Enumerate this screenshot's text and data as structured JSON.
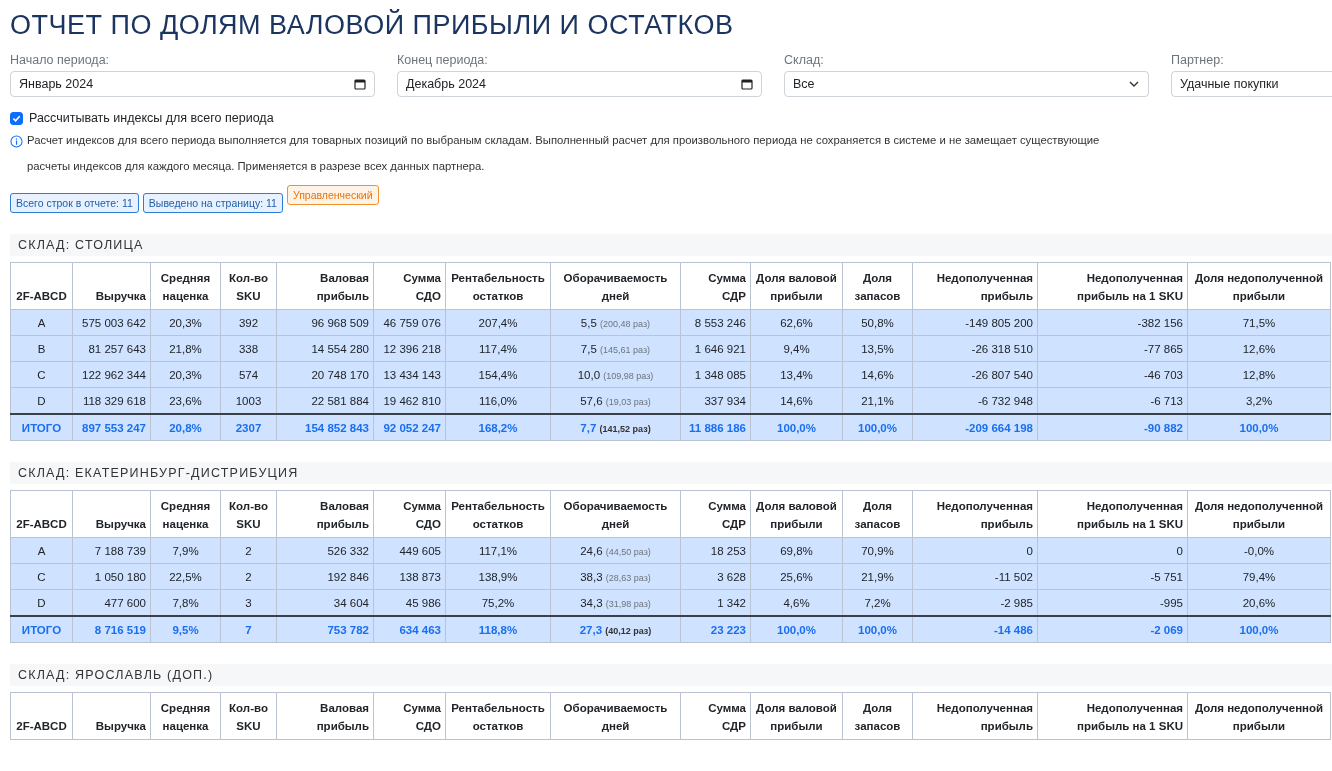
{
  "title": "ОТЧЕТ ПО ДОЛЯМ ВАЛОВОЙ ПРИБЫЛИ И ОСТАТКОВ",
  "filters": [
    {
      "label": "Начало периода:",
      "value": "Январь 2024",
      "kind": "date"
    },
    {
      "label": "Конец периода:",
      "value": "Декабрь 2024",
      "kind": "date"
    },
    {
      "label": "Склад:",
      "value": "Все",
      "kind": "select"
    },
    {
      "label": "Партнер:",
      "value": "Удачные покупки",
      "kind": "text"
    }
  ],
  "checkbox": {
    "label": "Рассчитывать индексы для всего периода",
    "checked": true
  },
  "info": "Расчет индексов для всего периода выполняется для товарных позиций по выбраным складам. Выполненный расчет для произвольного периода не сохраняется в системе и не замещает существующие расчеты индексов для каждого месяца. Применяется в разрезе всех данных партнера.",
  "badges": [
    {
      "text": "Всего строк в отчете: 11",
      "kind": "info"
    },
    {
      "text": "Выведено на страницу: 11",
      "kind": "info"
    },
    {
      "text": "Управленческий",
      "kind": "warning"
    }
  ],
  "sections": [
    {
      "title": "СКЛАД: СТОЛИЦА",
      "columns": [
        "2F-ABCD",
        "Выручка",
        "Средняя наценка",
        "Кол-во SKU",
        "Валовая прибыль",
        "Сумма СДО",
        "Рентабельность остатков",
        "Оборачиваемость дней",
        "Сумма СДР",
        "Доля валовой прибыли",
        "Доля запасов",
        "Недополученная прибыль",
        "Недополученная прибыль на 1 SKU",
        "Доля недополученной прибыли"
      ],
      "rows": [
        {
          "cells": [
            "A",
            "575 003 642",
            "20,3%",
            "392",
            "96 968 509",
            "46 759 076",
            "207,4%",
            {
              "value": "5,5",
              "note": "(200,48 раз)"
            },
            "8 553 246",
            "62,6%",
            "50,8%",
            "-149 805 200",
            "-382 156",
            "71,5%"
          ]
        },
        {
          "cells": [
            "B",
            "81 257 643",
            "21,8%",
            "338",
            "14 554 280",
            "12 396 218",
            "117,4%",
            {
              "value": "7,5",
              "note": "(145,61 раз)"
            },
            "1 646 921",
            "9,4%",
            "13,5%",
            "-26 318 510",
            "-77 865",
            "12,6%"
          ]
        },
        {
          "cells": [
            "C",
            "122 962 344",
            "20,3%",
            "574",
            "20 748 170",
            "13 434 143",
            "154,4%",
            {
              "value": "10,0",
              "note": "(109,98 раз)"
            },
            "1 348 085",
            "13,4%",
            "14,6%",
            "-26 807 540",
            "-46 703",
            "12,8%"
          ]
        },
        {
          "cells": [
            "D",
            "118 329 618",
            "23,6%",
            "1003",
            "22 581 884",
            "19 462 810",
            "116,0%",
            {
              "value": "57,6",
              "note": "(19,03 раз)"
            },
            "337 934",
            "14,6%",
            "21,1%",
            "-6 732 948",
            "-6 713",
            "3,2%"
          ]
        }
      ],
      "total": [
        "ИТОГО",
        "897 553 247",
        "20,8%",
        "2307",
        "154 852 843",
        "92 052 247",
        "168,2%",
        {
          "value": "7,7",
          "note": "(141,52 раз)"
        },
        "11 886 186",
        "100,0%",
        "100,0%",
        "-209 664 198",
        "-90 882",
        "100,0%"
      ]
    },
    {
      "title": "СКЛАД: ЕКАТЕРИНБУРГ-ДИСТРИБУЦИЯ",
      "columns": [
        "2F-ABCD",
        "Выручка",
        "Средняя наценка",
        "Кол-во SKU",
        "Валовая прибыль",
        "Сумма СДО",
        "Рентабельность остатков",
        "Оборачиваемость дней",
        "Сумма СДР",
        "Доля валовой прибыли",
        "Доля запасов",
        "Недополученная прибыль",
        "Недополученная прибыль на 1 SKU",
        "Доля недополученной прибыли"
      ],
      "rows": [
        {
          "cells": [
            "A",
            "7 188 739",
            "7,9%",
            "2",
            "526 332",
            "449 605",
            "117,1%",
            {
              "value": "24,6",
              "note": "(44,50 раз)"
            },
            "18 253",
            "69,8%",
            "70,9%",
            "0",
            "0",
            "-0,0%"
          ]
        },
        {
          "cells": [
            "C",
            "1 050 180",
            "22,5%",
            "2",
            "192 846",
            "138 873",
            "138,9%",
            {
              "value": "38,3",
              "note": "(28,63 раз)"
            },
            "3 628",
            "25,6%",
            "21,9%",
            "-11 502",
            "-5 751",
            "79,4%"
          ]
        },
        {
          "cells": [
            "D",
            "477 600",
            "7,8%",
            "3",
            "34 604",
            "45 986",
            "75,2%",
            {
              "value": "34,3",
              "note": "(31,98 раз)"
            },
            "1 342",
            "4,6%",
            "7,2%",
            "-2 985",
            "-995",
            "20,6%"
          ]
        }
      ],
      "total": [
        "ИТОГО",
        "8 716 519",
        "9,5%",
        "7",
        "753 782",
        "634 463",
        "118,8%",
        {
          "value": "27,3",
          "note": "(40,12 раз)"
        },
        "23 223",
        "100,0%",
        "100,0%",
        "-14 486",
        "-2 069",
        "100,0%"
      ]
    },
    {
      "title": "СКЛАД: ЯРОСЛАВЛЬ (ДОП.)",
      "columns": [
        "2F-ABCD",
        "Выручка",
        "Средняя наценка",
        "Кол-во SKU",
        "Валовая прибыль",
        "Сумма СДО",
        "Рентабельность остатков",
        "Оборачиваемость дней",
        "Сумма СДР",
        "Доля валовой прибыли",
        "Доля запасов",
        "Недополученная прибыль",
        "Недополученная прибыль на 1 SKU",
        "Доля недополученной прибыли"
      ]
    }
  ]
}
